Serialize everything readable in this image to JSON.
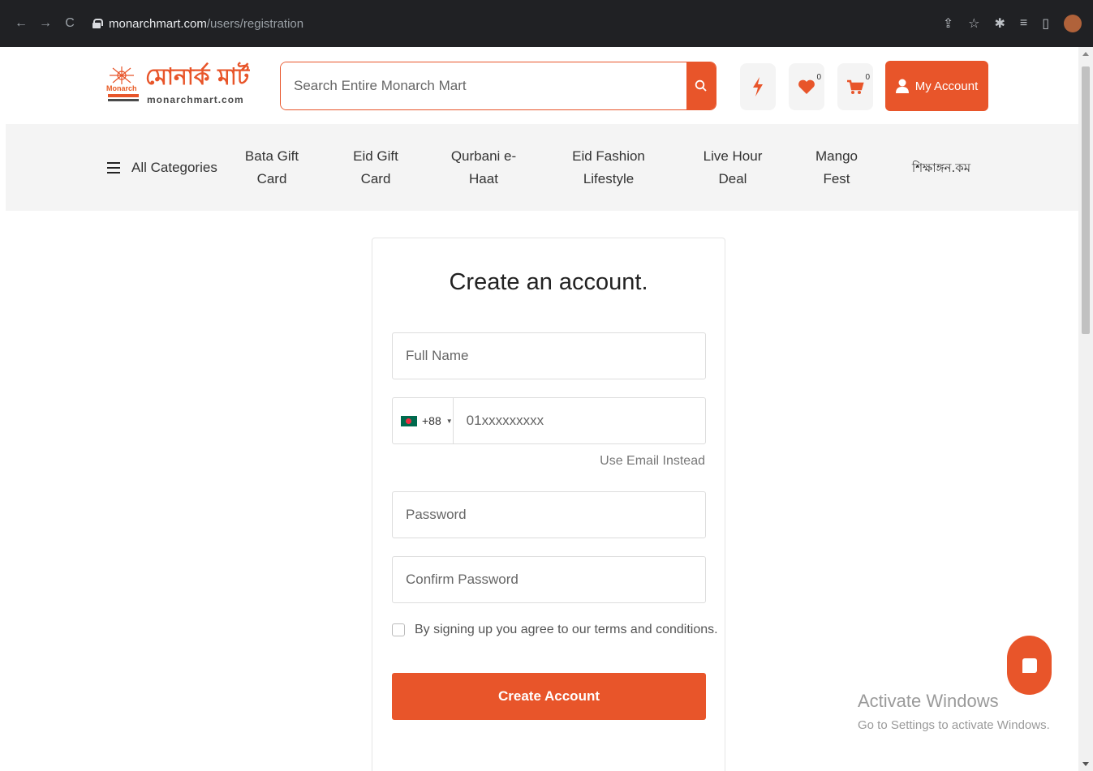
{
  "browser": {
    "url_host": "monarchmart.com",
    "url_path": "/users/registration"
  },
  "header": {
    "logo_brand_en": "Monarch",
    "logo_name_bn": "মোনার্ক মার্ট",
    "logo_domain": "monarchmart.com",
    "search_placeholder": "Search Entire Monarch Mart",
    "wishlist_count": "0",
    "cart_count": "0",
    "account_label": "My Account"
  },
  "categories": {
    "all_label": "All Categories",
    "items": [
      {
        "line1": "Bata Gift",
        "line2": "Card"
      },
      {
        "line1": "Eid Gift",
        "line2": "Card"
      },
      {
        "line1": "Qurbani e-",
        "line2": "Haat"
      },
      {
        "line1": "Eid Fashion",
        "line2": "Lifestyle"
      },
      {
        "line1": "Live Hour",
        "line2": "Deal"
      },
      {
        "line1": "Mango",
        "line2": "Fest"
      },
      {
        "line1": "শিক্ষাঙ্গন.কম",
        "line2": ""
      }
    ]
  },
  "form": {
    "title": "Create an account.",
    "full_name_placeholder": "Full Name",
    "country_code": "+88",
    "phone_placeholder": "01xxxxxxxxx",
    "use_email_label": "Use Email Instead",
    "password_placeholder": "Password",
    "confirm_password_placeholder": "Confirm Password",
    "terms_label": "By signing up you agree to our terms and conditions.",
    "submit_label": "Create Account"
  },
  "watermark": {
    "title": "Activate Windows",
    "subtitle": "Go to Settings to activate Windows."
  },
  "colors": {
    "accent": "#e8552a",
    "nav_bg": "#f4f4f4"
  }
}
